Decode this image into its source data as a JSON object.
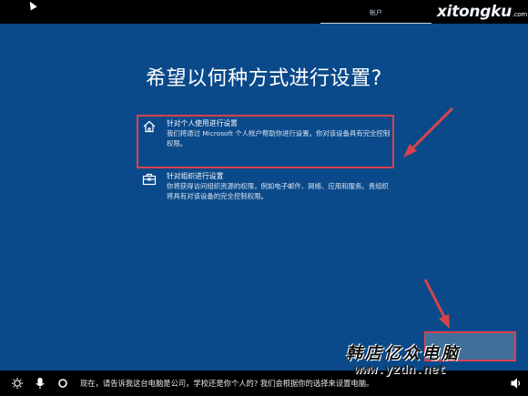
{
  "window": {
    "step_tab": "帐户",
    "watermark_top": "xitongku",
    "watermark_top_suffix": ".com"
  },
  "main": {
    "title": "希望以何种方式进行设置?",
    "options": [
      {
        "icon": "home-icon",
        "title": "针对个人使用进行设置",
        "description": "我们将通过 Microsoft 个人帐户帮助你进行设置。你对该设备具有完全控制权限。"
      },
      {
        "icon": "briefcase-icon",
        "title": "针对组织进行设置",
        "description": "你将获得访问组织资源的权限，例如电子邮件、网络、应用和服务。贵组织将具有对该设备的完全控制权限。"
      }
    ]
  },
  "overlay": {
    "stamp_text": "韩店亿众电脑",
    "stamp_url": "www.yzdn.net"
  },
  "taskbar": {
    "narration_text": "现在，请告诉我这台电脑是公司，学校还是你个人的? 我们会根据你的选择来设置电脑。",
    "icons": [
      "ease-of-access-icon",
      "microphone-icon",
      "cortana-circle-icon",
      "volume-icon"
    ]
  },
  "colors": {
    "background": "#0b4a8a",
    "highlight_border": "#d8434b",
    "taskbar": "#000000"
  }
}
